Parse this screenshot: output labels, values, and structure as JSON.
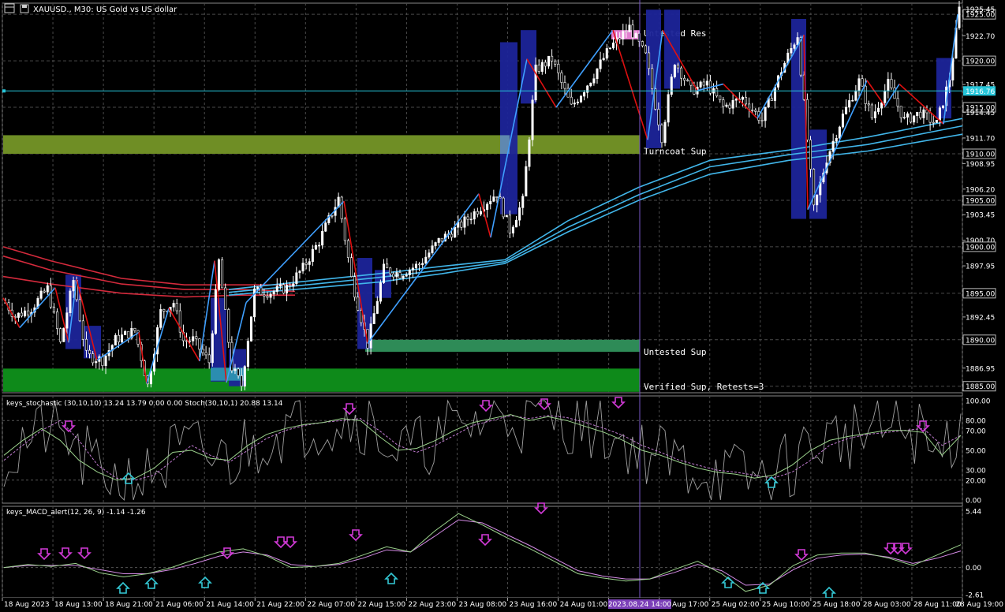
{
  "window": {
    "symbol_title": "XAUUSD., M30:  US Gold vs US dollar"
  },
  "colors": {
    "background": "#000000",
    "grid": "#4a4a4a",
    "bull_candle": "#ffffff",
    "bear_candle": "#000000",
    "candle_wick": "#ffffff",
    "zigzag_up": "#3fa0ff",
    "zigzag_down": "#e01010",
    "ma_red": "#d42a3c",
    "ma_blue": "#41b6ea",
    "crosshair_line": "#26c6da",
    "price_tag": "#26c6da",
    "vline": "#7a57c9",
    "resistance_zone": "#e27ed0",
    "turncoat_zone": "#6f8e25",
    "untested_sup_zone": "#2e8b57",
    "verified_sup_zone": "#0e8a1a",
    "highlight_box": "#1c2499",
    "stoch_main": "#9bd28c",
    "stoch_signal": "#c27bd2",
    "stoch_raw": "#a0a0a0",
    "macd_main": "#9bd28c",
    "macd_signal": "#d58be6",
    "arrow_down": "#d23ad7",
    "arrow_up": "#34c9d6"
  },
  "main_chart": {
    "y_axis_ticks": [
      "1925.00",
      "1922.70",
      "1920.00",
      "1917.45",
      "1915.00",
      "1914.45",
      "1911.70",
      "1910.00",
      "1908.95",
      "1906.20",
      "1905.00",
      "1903.45",
      "1900.70",
      "1900.00",
      "1897.95",
      "1895.00",
      "1892.45",
      "1890.00",
      "1886.95",
      "1885.00"
    ],
    "boxed_ticks": [
      "1925.00",
      "1920.00",
      "1915.00",
      "1910.00",
      "1905.00",
      "1900.00",
      "1895.00",
      "1890.00",
      "1885.00"
    ],
    "current_price": "1916.76",
    "top_tick_partial": "1925.45",
    "zones": [
      {
        "label": "Untested Res",
        "from": 1922.3,
        "to": 1923.3
      },
      {
        "label": "Turncoat Sup",
        "from": 1910.0,
        "to": 1912.0
      },
      {
        "label": "Untested Sup",
        "from": 1888.7,
        "to": 1890.0
      },
      {
        "label": "Verified Sup, Retests=3",
        "from": 1884.4,
        "to": 1886.9
      }
    ]
  },
  "stochastic": {
    "title": "keys_stochastic (30,10,10) 13.24 13.79 0.00 0.00  Stoch(30,10,1) 20.88 13.14",
    "y_ticks": [
      "100.00",
      "80.00",
      "70.00",
      "50.00",
      "30.00",
      "20.00",
      "0.00"
    ],
    "series": [
      "keys_stochastic",
      "Stoch(30,10,1)"
    ]
  },
  "macd": {
    "title": "keys_MACD_alert(12, 26, 9) -1.14 -1.26",
    "y_ticks": [
      "5.44",
      "0.00",
      "-2.61"
    ],
    "series": [
      "keys_MACD_alert main",
      "keys_MACD_alert signal"
    ]
  },
  "x_axis": {
    "labels": [
      "18 Aug 2023",
      "18 Aug 13:00",
      "18 Aug 21:00",
      "21 Aug 06:00",
      "21 Aug 14:00",
      "21 Aug 22:00",
      "22 Aug 07:00",
      "22 Aug 15:00",
      "22 Aug 23:00",
      "23 Aug 08:00",
      "23 Aug 16:00",
      "24 Aug 01:00",
      "24 Aug 09:00",
      "24 Aug 17:00",
      "25 Aug 02:00",
      "25 Aug 10:00",
      "25 Aug 18:00",
      "28 Aug 03:00",
      "28 Aug 11:00",
      "28 Aug 19:00"
    ],
    "highlight_label": "2023.08.24 14:00"
  },
  "chart_data": [
    {
      "type": "candlestick",
      "title": "XAUUSD., M30:  US Gold vs US dollar",
      "timeframe": "M30",
      "ylim": [
        1884.3,
        1926.2
      ],
      "close_path_anchors": [
        {
          "bar": 0,
          "price": 1894.0
        },
        {
          "bar": 3,
          "price": 1892.5
        },
        {
          "bar": 8,
          "price": 1893.4
        },
        {
          "bar": 13,
          "price": 1895.5
        },
        {
          "bar": 17,
          "price": 1889.6
        },
        {
          "bar": 21,
          "price": 1896.4
        },
        {
          "bar": 25,
          "price": 1888.3
        },
        {
          "bar": 30,
          "price": 1887.8
        },
        {
          "bar": 34,
          "price": 1890.0
        },
        {
          "bar": 40,
          "price": 1891.0
        },
        {
          "bar": 44,
          "price": 1885.1
        },
        {
          "bar": 48,
          "price": 1893.0
        },
        {
          "bar": 52,
          "price": 1894.0
        },
        {
          "bar": 55,
          "price": 1889.9
        },
        {
          "bar": 58,
          "price": 1890.0
        },
        {
          "bar": 63,
          "price": 1887.6
        },
        {
          "bar": 66,
          "price": 1898.4
        },
        {
          "bar": 70,
          "price": 1887.0
        },
        {
          "bar": 73,
          "price": 1885.1
        },
        {
          "bar": 77,
          "price": 1895.2
        },
        {
          "bar": 82,
          "price": 1895.1
        },
        {
          "bar": 87,
          "price": 1895.6
        },
        {
          "bar": 92,
          "price": 1897.7
        },
        {
          "bar": 97,
          "price": 1900.6
        },
        {
          "bar": 103,
          "price": 1905.2
        },
        {
          "bar": 107,
          "price": 1896.6
        },
        {
          "bar": 112,
          "price": 1889.5
        },
        {
          "bar": 117,
          "price": 1897.6
        },
        {
          "bar": 122,
          "price": 1897.1
        },
        {
          "bar": 128,
          "price": 1898.1
        },
        {
          "bar": 134,
          "price": 1900.6
        },
        {
          "bar": 140,
          "price": 1902.1
        },
        {
          "bar": 146,
          "price": 1904.0
        },
        {
          "bar": 152,
          "price": 1905.8
        },
        {
          "bar": 156,
          "price": 1901.8
        },
        {
          "bar": 160,
          "price": 1904.9
        },
        {
          "bar": 164,
          "price": 1919.0
        },
        {
          "bar": 169,
          "price": 1920.2
        },
        {
          "bar": 175,
          "price": 1915.0
        },
        {
          "bar": 181,
          "price": 1918.0
        },
        {
          "bar": 187,
          "price": 1921.4
        },
        {
          "bar": 193,
          "price": 1923.6
        },
        {
          "bar": 198,
          "price": 1920.5
        },
        {
          "bar": 203,
          "price": 1911.8
        },
        {
          "bar": 207,
          "price": 1920.0
        },
        {
          "bar": 212,
          "price": 1916.8
        },
        {
          "bar": 217,
          "price": 1917.5
        },
        {
          "bar": 222,
          "price": 1915.0
        },
        {
          "bar": 228,
          "price": 1916.0
        },
        {
          "bar": 234,
          "price": 1913.6
        },
        {
          "bar": 240,
          "price": 1919.0
        },
        {
          "bar": 245,
          "price": 1922.8
        },
        {
          "bar": 250,
          "price": 1904.0
        },
        {
          "bar": 254,
          "price": 1909.5
        },
        {
          "bar": 259,
          "price": 1914.1
        },
        {
          "bar": 264,
          "price": 1917.8
        },
        {
          "bar": 268,
          "price": 1913.9
        },
        {
          "bar": 273,
          "price": 1917.5
        },
        {
          "bar": 278,
          "price": 1913.6
        },
        {
          "bar": 283,
          "price": 1914.4
        },
        {
          "bar": 288,
          "price": 1913.2
        },
        {
          "bar": 292,
          "price": 1918.1
        },
        {
          "bar": 295,
          "price": 1925.5
        }
      ],
      "bar_count": 296
    },
    {
      "type": "line",
      "title": "keys_stochastic (30,10,10) 13.24 13.79 0.00 0.00  Stoch(30,10,1) 20.88 13.14",
      "ylim": [
        0,
        100
      ],
      "series": [
        {
          "name": "keys_stochastic",
          "values": [
            40,
            55,
            70,
            80,
            60,
            35,
            22,
            20,
            25,
            40,
            55,
            45,
            38,
            50,
            62,
            70,
            75,
            78,
            80,
            82,
            70,
            55,
            48,
            55,
            65,
            75,
            80,
            85,
            82,
            85,
            83,
            78,
            72,
            65,
            55,
            48,
            40,
            35,
            30,
            28,
            25,
            22,
            28,
            40,
            55,
            62,
            66,
            68,
            70,
            72,
            55,
            65
          ]
        },
        {
          "name": "Stoch(30,10,1)",
          "values": [
            45,
            60,
            72,
            60,
            40,
            28,
            20,
            22,
            32,
            48,
            50,
            42,
            40,
            55,
            66,
            72,
            76,
            78,
            82,
            80,
            64,
            50,
            52,
            60,
            70,
            78,
            82,
            86,
            80,
            84,
            80,
            74,
            68,
            60,
            50,
            45,
            38,
            32,
            28,
            26,
            22,
            25,
            35,
            50,
            60,
            64,
            67,
            70,
            70,
            68,
            45,
            65
          ]
        }
      ]
    },
    {
      "type": "line",
      "title": "keys_MACD_alert(12, 26, 9) -1.14 -1.26",
      "ylim": [
        -2.61,
        5.44
      ],
      "series": [
        {
          "name": "main",
          "values": [
            0.0,
            0.3,
            0.1,
            0.4,
            -0.5,
            -0.9,
            -0.6,
            0.0,
            0.8,
            1.5,
            1.8,
            1.1,
            0.0,
            0.1,
            0.4,
            1.2,
            2.0,
            1.5,
            3.5,
            5.2,
            4.1,
            2.9,
            1.8,
            0.6,
            -0.6,
            -1.0,
            -1.3,
            -1.1,
            -0.2,
            0.6,
            -0.6,
            -2.3,
            -1.7,
            0.2,
            1.2,
            1.4,
            1.4,
            0.9,
            0.2,
            1.2,
            2.2
          ]
        },
        {
          "name": "signal",
          "values": [
            0.0,
            0.2,
            0.2,
            0.2,
            -0.2,
            -0.6,
            -0.6,
            -0.2,
            0.4,
            1.1,
            1.5,
            1.2,
            0.3,
            0.1,
            0.3,
            0.9,
            1.7,
            1.5,
            3.0,
            4.6,
            4.3,
            3.2,
            2.1,
            0.9,
            -0.3,
            -0.8,
            -1.1,
            -1.1,
            -0.5,
            0.3,
            -0.3,
            -1.7,
            -1.6,
            -0.2,
            0.9,
            1.2,
            1.3,
            1.0,
            0.4,
            0.9,
            1.6
          ]
        }
      ]
    }
  ]
}
